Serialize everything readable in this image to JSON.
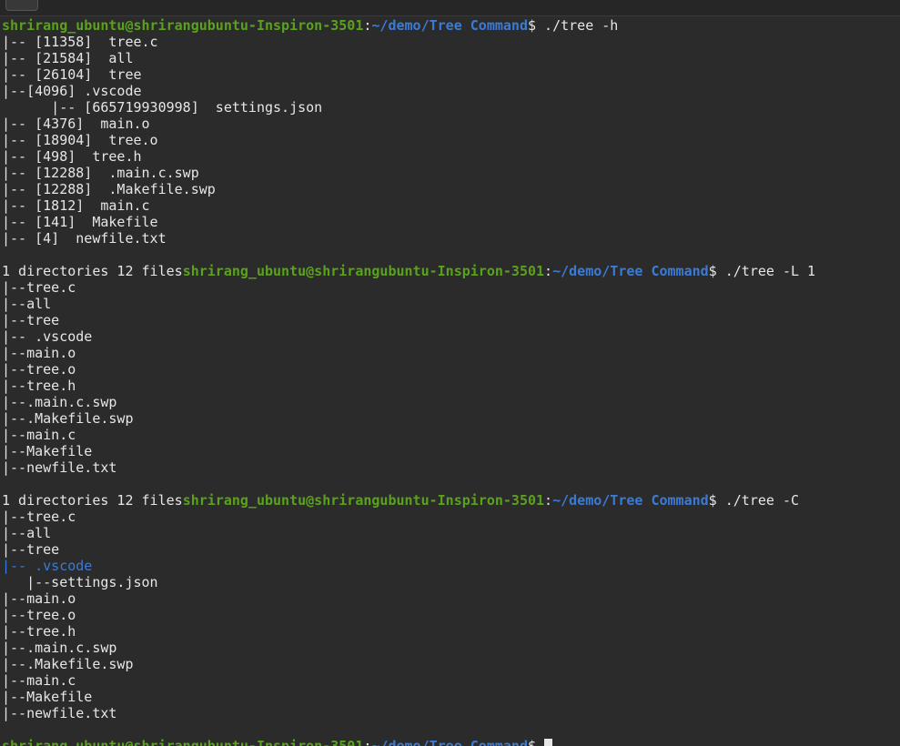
{
  "prompt": {
    "user": "shrirang_ubuntu@shrirangubuntu-Inspiron-3501",
    "colon": ":",
    "path": "~/demo/Tree Command",
    "dollar": "$ "
  },
  "blocks": [
    {
      "command": "./tree -h",
      "lines": [
        "|-- [11358]  tree.c",
        "|-- [21584]  all",
        "|-- [26104]  tree",
        "|--[4096] .vscode",
        "      |-- [665719930998]  settings.json",
        "|-- [4376]  main.o",
        "|-- [18904]  tree.o",
        "|-- [498]  tree.h",
        "|-- [12288]  .main.c.swp",
        "|-- [12288]  .Makefile.swp",
        "|-- [1812]  main.c",
        "|-- [141]  Makefile",
        "|-- [4]  newfile.txt",
        ""
      ],
      "summary": "1 directories 12 files"
    },
    {
      "command": "./tree -L 1",
      "lines": [
        "|--tree.c",
        "|--all",
        "|--tree",
        "|-- .vscode",
        "|--main.o",
        "|--tree.o",
        "|--tree.h",
        "|--.main.c.swp",
        "|--.Makefile.swp",
        "|--main.c",
        "|--Makefile",
        "|--newfile.txt",
        ""
      ],
      "summary": "1 directories 12 files"
    },
    {
      "command": "./tree -C",
      "lines": [
        "|--tree.c",
        "|--all",
        "|--tree",
        "|-- .vscode",
        "   |--settings.json",
        "|--main.o",
        "|--tree.o",
        "|--tree.h",
        "|--.main.c.swp",
        "|--.Makefile.swp",
        "|--main.c",
        "|--Makefile",
        "|--newfile.txt",
        ""
      ],
      "colored_line_index": 3
    }
  ],
  "colors": {
    "background": "#2b2b2b",
    "text": "#e6e6e6",
    "user": "#5aa21b",
    "path": "#3b7bd6",
    "directory": "#3b7bd6"
  }
}
